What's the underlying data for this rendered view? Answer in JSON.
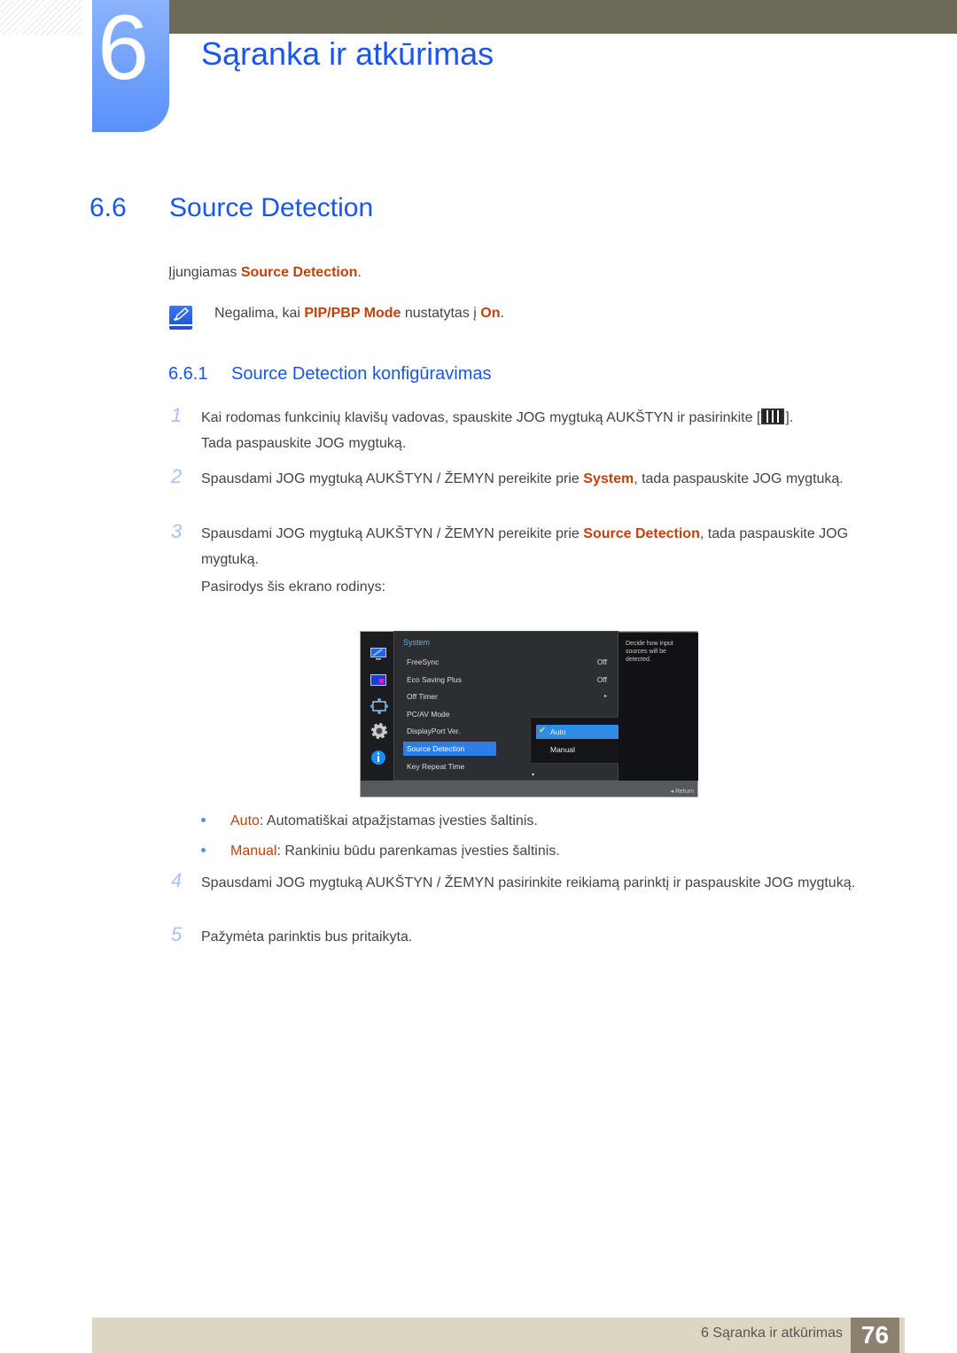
{
  "header": {
    "chapter_number": "6",
    "chapter_title": "Sąranka ir atkūrimas"
  },
  "section": {
    "number": "6.6",
    "title": "Source Detection",
    "intro_prefix": "Įjungiamas ",
    "intro_highlight": "Source Detection",
    "intro_suffix": ".",
    "note": {
      "prefix": "Negalima, kai ",
      "highlight1": "PIP/PBP Mode",
      "middle": " nustatytas į ",
      "highlight2": "On",
      "suffix": "."
    }
  },
  "subsection": {
    "number": "6.6.1",
    "title": "Source Detection konfigūravimas"
  },
  "steps": [
    {
      "num": "1",
      "line1_prefix": "Kai rodomas funkcinių klavišų vadovas, spauskite JOG mygtuką AUKŠTYN ir pasirinkite [",
      "line1_suffix": "].",
      "line2": "Tada paspauskite JOG mygtuką."
    },
    {
      "num": "2",
      "prefix": "Spausdami JOG mygtuką AUKŠTYN / ŽEMYN pereikite prie ",
      "highlight": "System",
      "suffix": ", tada paspauskite JOG mygtuką."
    },
    {
      "num": "3",
      "prefix": "Spausdami JOG mygtuką AUKŠTYN / ŽEMYN pereikite prie ",
      "highlight": "Source Detection",
      "suffix": ", tada paspauskite JOG mygtuką.",
      "after": "Pasirodys šis ekrano rodinys:"
    },
    {
      "num": "4",
      "text": "Spausdami JOG mygtuką AUKŠTYN / ŽEMYN pasirinkite reikiamą parinktį ir paspauskite JOG mygtuką."
    },
    {
      "num": "5",
      "text": "Pažymėta parinktis bus pritaikyta."
    }
  ],
  "osd": {
    "title": "System",
    "items": [
      {
        "label": "FreeSync",
        "value": "Off"
      },
      {
        "label": "Eco Saving Plus",
        "value": "Off"
      },
      {
        "label": "Off Timer",
        "value": "▸"
      },
      {
        "label": "PC/AV Mode",
        "value": ""
      },
      {
        "label": "DisplayPort Ver.",
        "value": ""
      },
      {
        "label": "Source Detection",
        "value": ""
      },
      {
        "label": "Key Repeat Time",
        "value": ""
      }
    ],
    "submenu": [
      {
        "label": "Auto",
        "checked": true
      },
      {
        "label": "Manual",
        "checked": false
      }
    ],
    "info": "Decide how input sources will be detected.",
    "return_label": "◂  Return",
    "scroll_indicator": "▾",
    "checkmark": "✔"
  },
  "options": [
    {
      "name": "Auto",
      "desc": ": Automatiškai atpažįstamas įvesties šaltinis."
    },
    {
      "name": "Manual",
      "desc": ": Rankiniu būdu parenkamas įvesties šaltinis."
    }
  ],
  "footer": {
    "text": "6 Sąranka ir atkūrimas",
    "page": "76"
  }
}
